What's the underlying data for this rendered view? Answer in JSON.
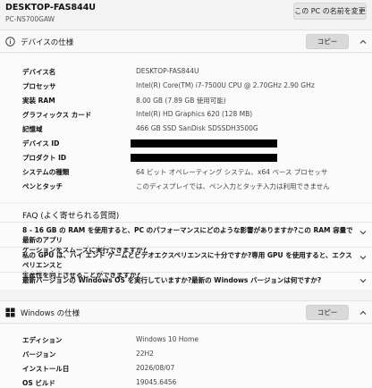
{
  "header": {
    "pc_name": "DESKTOP-FAS844U",
    "pc_model": "PC-NS700GAW",
    "rename_button": "この PC の名前を変更"
  },
  "device_specs": {
    "title": "デバイスの仕様",
    "copy_button": "コピー",
    "rows": [
      {
        "label": "デバイス名",
        "value": "DESKTOP-FAS844U"
      },
      {
        "label": "プロセッサ",
        "value": "Intel(R) Core(TM) i7-7500U CPU @ 2.70GHz   2.90 GHz"
      },
      {
        "label": "実装 RAM",
        "value": "8.00 GB (7.89 GB 使用可能)"
      },
      {
        "label": "グラフィックス カード",
        "value": "Intel(R) HD Graphics 620 (128 MB)"
      },
      {
        "label": "記憶域",
        "value": "466 GB SSD SanDisk SDSSDH3500G"
      },
      {
        "label": "デバイス ID",
        "value": ""
      },
      {
        "label": "プロダクト ID",
        "value": ""
      },
      {
        "label": "システムの種類",
        "value": "64 ビット オペレーティング システム、x64 ベース プロセッサ"
      },
      {
        "label": "ペンとタッチ",
        "value": "このディスプレイでは、ペン入力とタッチ入力は利用できません"
      }
    ]
  },
  "faq": {
    "title": "FAQ (よく寄せられる質問)",
    "items": [
      {
        "line1": "8 - 16 GB の RAM を使用すると、PC のパフォーマンスにどのような影響がありますか?この RAM 容量で最新のアプリ",
        "line2": "ケーションをスムーズに実行できますか?"
      },
      {
        "line1": "私の GPU は、ハイ エンド ゲームとビデオエクスペリエンスに十分ですか?専用 GPU を使用すると、エクスペリエンスと",
        "line2": "生産性を向上させることができますか?"
      },
      {
        "line1": "最新バージョンの Windows OS を実行していますか?最新の Windows バージョンは何ですか?",
        "line2": ""
      }
    ]
  },
  "windows_specs": {
    "title": "Windows の仕様",
    "copy_button": "コピー",
    "rows": [
      {
        "label": "エディション",
        "value": "Windows 10 Home"
      },
      {
        "label": "バージョン",
        "value": "22H2"
      },
      {
        "label": "インストール日",
        "value": "2026/08/07"
      },
      {
        "label": "OS ビルド",
        "value": "19045.6456"
      }
    ]
  },
  "colors": {
    "accent": "#0067c0",
    "background": "#f3f3f3"
  }
}
